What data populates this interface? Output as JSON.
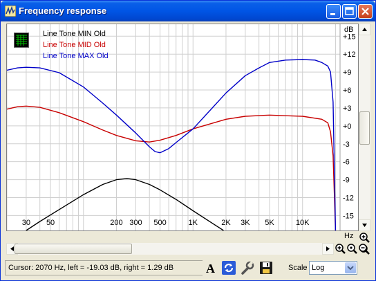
{
  "window": {
    "title": "Frequency response",
    "icon": "waveform-app-icon",
    "controls": [
      "minimize-icon",
      "maximize-icon",
      "close-icon"
    ]
  },
  "legend": [
    {
      "label": "Line Tone MIN Old",
      "color": "#000000"
    },
    {
      "label": "Line Tone MID Old",
      "color": "#C80000"
    },
    {
      "label": "Line Tone MAX Old",
      "color": "#0000C8"
    }
  ],
  "y_unit": "dB",
  "x_unit": "Hz",
  "chart_data": {
    "type": "line",
    "x_scale": "log",
    "xlim": [
      20,
      22000
    ],
    "ylim": [
      -17.5,
      17
    ],
    "grid": true,
    "yticks": [
      15,
      12,
      9,
      6,
      3,
      0,
      -3,
      -6,
      -9,
      -12,
      -15
    ],
    "ytick_labels": [
      "+15",
      "+12",
      "+9",
      "+6",
      "+3",
      "+0",
      "-3",
      "-6",
      "-9",
      "-12",
      "-15"
    ],
    "xtick_labels": [
      {
        "value": 30,
        "label": "30"
      },
      {
        "value": 50,
        "label": "50"
      },
      {
        "value": 200,
        "label": "200"
      },
      {
        "value": 300,
        "label": "300"
      },
      {
        "value": 500,
        "label": "500"
      },
      {
        "value": 1000,
        "label": "1K"
      },
      {
        "value": 2000,
        "label": "2K"
      },
      {
        "value": 3000,
        "label": "3K"
      },
      {
        "value": 5000,
        "label": "5K"
      },
      {
        "value": 10000,
        "label": "10K"
      }
    ],
    "series": [
      {
        "name": "Line Tone MIN Old",
        "color": "#000000",
        "points": [
          [
            30,
            -17.5
          ],
          [
            40,
            -16
          ],
          [
            60,
            -14
          ],
          [
            100,
            -11.5
          ],
          [
            150,
            -9.8
          ],
          [
            200,
            -9
          ],
          [
            250,
            -8.8
          ],
          [
            300,
            -9
          ],
          [
            400,
            -9.8
          ],
          [
            500,
            -10.7
          ],
          [
            700,
            -12.3
          ],
          [
            1000,
            -14.2
          ],
          [
            1500,
            -16.3
          ],
          [
            1900,
            -17.5
          ]
        ]
      },
      {
        "name": "Line Tone MID Old",
        "color": "#C80000",
        "points": [
          [
            20,
            2.8
          ],
          [
            25,
            3.2
          ],
          [
            30,
            3.3
          ],
          [
            40,
            3.1
          ],
          [
            60,
            2.2
          ],
          [
            100,
            0.7
          ],
          [
            150,
            -0.7
          ],
          [
            200,
            -1.6
          ],
          [
            300,
            -2.5
          ],
          [
            400,
            -2.7
          ],
          [
            500,
            -2.4
          ],
          [
            700,
            -1.6
          ],
          [
            1000,
            -0.5
          ],
          [
            2000,
            1.1
          ],
          [
            3000,
            1.6
          ],
          [
            5000,
            1.8
          ],
          [
            7000,
            1.7
          ],
          [
            10000,
            1.6
          ],
          [
            15000,
            1.1
          ],
          [
            17000,
            0.5
          ],
          [
            18000,
            -1
          ],
          [
            19000,
            -5
          ],
          [
            20000,
            -17.5
          ]
        ]
      },
      {
        "name": "Line Tone MAX Old",
        "color": "#0000C8",
        "points": [
          [
            20,
            9.3
          ],
          [
            25,
            9.7
          ],
          [
            30,
            9.8
          ],
          [
            40,
            9.7
          ],
          [
            60,
            8.9
          ],
          [
            100,
            6.5
          ],
          [
            150,
            3.8
          ],
          [
            200,
            1.8
          ],
          [
            300,
            -1.2
          ],
          [
            400,
            -3.5
          ],
          [
            450,
            -4.3
          ],
          [
            500,
            -4.5
          ],
          [
            600,
            -3.8
          ],
          [
            700,
            -2.8
          ],
          [
            1000,
            -0.5
          ],
          [
            1500,
            3
          ],
          [
            2000,
            5.5
          ],
          [
            3000,
            8.4
          ],
          [
            4000,
            9.7
          ],
          [
            5000,
            10.6
          ],
          [
            7000,
            11
          ],
          [
            10000,
            11.1
          ],
          [
            13000,
            11
          ],
          [
            15000,
            10.6
          ],
          [
            17000,
            10
          ],
          [
            18000,
            9
          ],
          [
            19000,
            4
          ],
          [
            20000,
            -17.5
          ]
        ]
      }
    ]
  },
  "statusbar": {
    "cursor_text": "Cursor:  2070 Hz,  left = -19.03 dB,  right = 1.29 dB",
    "scale_label": "Scale",
    "scale_value": "Log"
  },
  "toolbar_icons": [
    "font-icon",
    "refresh-icon",
    "wrench-icon",
    "save-icon"
  ]
}
